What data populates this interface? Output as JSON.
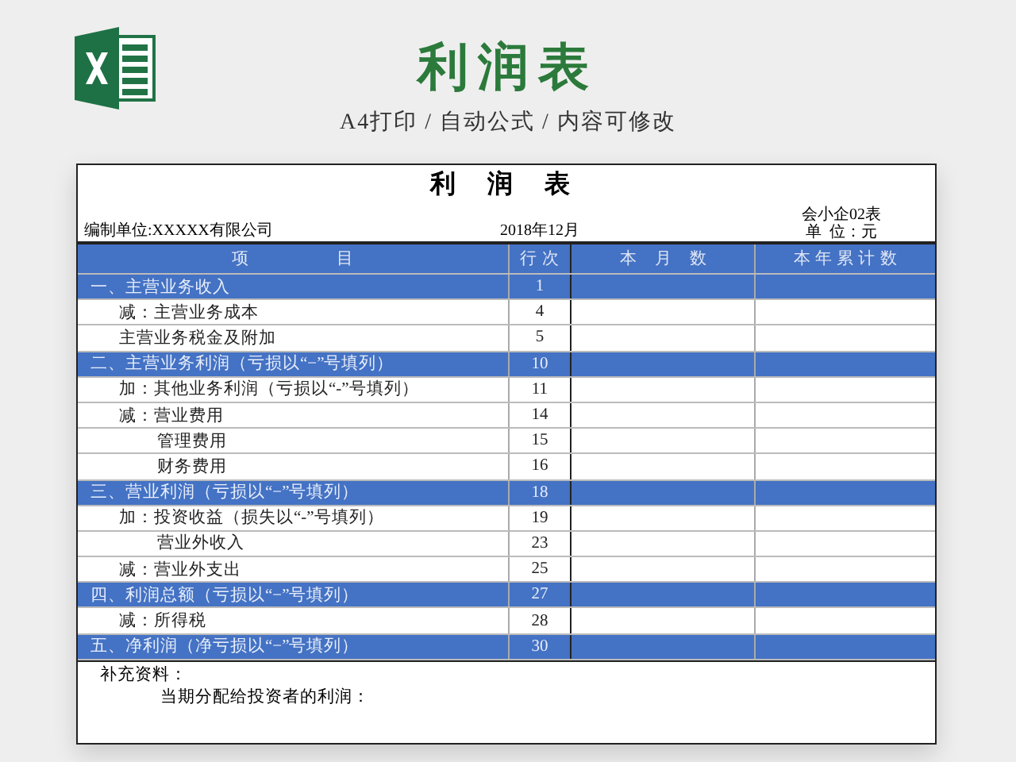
{
  "banner": {
    "title": "利润表",
    "subtitle": "A4打印 / 自动公式 / 内容可修改"
  },
  "sheet": {
    "title": "利 润 表",
    "form_code": "会小企02表",
    "company": "编制单位:XXXXX有限公司",
    "period": "2018年12月",
    "unit": "单  位：元",
    "columns": [
      "项　　　　　目",
      "行 次",
      "本　月　数",
      "本 年 累 计 数"
    ],
    "rows": [
      {
        "kind": "section",
        "item": "一、主营业务收入",
        "line": "1"
      },
      {
        "kind": "item",
        "item": "减：主营业务成本",
        "line": "4"
      },
      {
        "kind": "item",
        "item": "主营业务税金及附加",
        "line": "5"
      },
      {
        "kind": "section",
        "item": "二、主营业务利润（亏损以“−”号填列）",
        "line": "10"
      },
      {
        "kind": "item",
        "item": "加：其他业务利润（亏损以“-”号填列）",
        "line": "11"
      },
      {
        "kind": "item",
        "item": "减：营业费用",
        "line": "14"
      },
      {
        "kind": "subitem",
        "item": "管理费用",
        "line": "15"
      },
      {
        "kind": "subitem",
        "item": "财务费用",
        "line": "16"
      },
      {
        "kind": "section",
        "item": "三、营业利润（亏损以“−”号填列）",
        "line": "18"
      },
      {
        "kind": "item",
        "item": "加：投资收益（损失以“-”号填列）",
        "line": "19"
      },
      {
        "kind": "subitem",
        "item": "营业外收入",
        "line": "23"
      },
      {
        "kind": "item",
        "item": "减：营业外支出",
        "line": "25"
      },
      {
        "kind": "section",
        "item": "四、利润总额（亏损以“−”号填列）",
        "line": "27"
      },
      {
        "kind": "item",
        "item": "减：所得税",
        "line": "28"
      },
      {
        "kind": "section",
        "item": "五、净利润（净亏损以“−”号填列）",
        "line": "30"
      }
    ],
    "notes": [
      "补充资料：",
      "当期分配给投资者的利润："
    ]
  }
}
